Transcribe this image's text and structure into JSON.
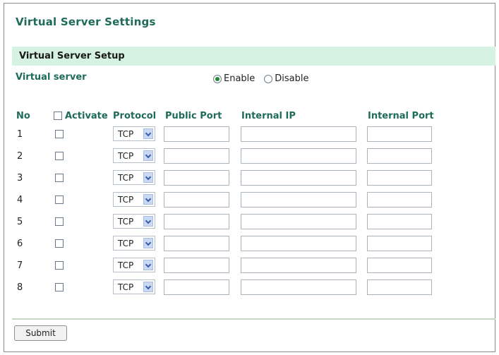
{
  "page_title": "Virtual Server Settings",
  "section_title": "Virtual Server Setup",
  "virtual_server": {
    "label": "Virtual server",
    "options": [
      {
        "label": "Enable",
        "checked": true
      },
      {
        "label": "Disable",
        "checked": false
      }
    ]
  },
  "table": {
    "headers": {
      "no": "No",
      "activate": "Activate",
      "protocol": "Protocol",
      "public_port": "Public Port",
      "internal_ip": "Internal IP",
      "internal_port": "Internal Port"
    },
    "rows": [
      {
        "no": "1",
        "protocol": "TCP"
      },
      {
        "no": "2",
        "protocol": "TCP"
      },
      {
        "no": "3",
        "protocol": "TCP"
      },
      {
        "no": "4",
        "protocol": "TCP"
      },
      {
        "no": "5",
        "protocol": "TCP"
      },
      {
        "no": "6",
        "protocol": "TCP"
      },
      {
        "no": "7",
        "protocol": "TCP"
      },
      {
        "no": "8",
        "protocol": "TCP"
      }
    ]
  },
  "submit_label": "Submit",
  "colors": {
    "title_green": "#1e6b58",
    "section_bg": "#d6f2e2"
  }
}
